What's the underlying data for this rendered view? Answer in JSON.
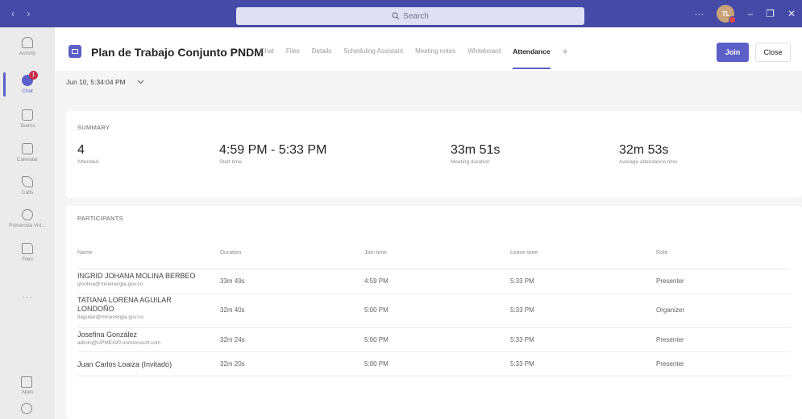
{
  "search": {
    "placeholder": "Search"
  },
  "titlebar": {
    "avatar_initials": "TL",
    "more": "···"
  },
  "rail": {
    "items": [
      {
        "label": "Activity",
        "icon": "bell-icon"
      },
      {
        "label": "Chat",
        "icon": "chat-icon",
        "badge": "1"
      },
      {
        "label": "Teams",
        "icon": "teams-icon"
      },
      {
        "label": "Calendar",
        "icon": "calendar-icon"
      },
      {
        "label": "Calls",
        "icon": "phone-icon"
      },
      {
        "label": "Presencia Virt...",
        "icon": "app-icon"
      },
      {
        "label": "Files",
        "icon": "file-icon"
      }
    ],
    "more": "···",
    "apps_label": "Apps"
  },
  "meeting": {
    "title": "Plan de Trabajo Conjunto PNDM",
    "tabs": [
      "Chat",
      "Files",
      "Details",
      "Scheduling Assistant",
      "Meeting notes",
      "Whiteboard",
      "Attendance"
    ],
    "active_tab": "Attendance",
    "add_tab": "+",
    "join_label": "Join",
    "close_label": "Close"
  },
  "date_selector": {
    "value": "Jun 10, 5:34:04 PM"
  },
  "summary": {
    "label": "SUMMARY",
    "stats": [
      {
        "value": "4",
        "caption": "Attended"
      },
      {
        "value": "4:59 PM - 5:33 PM",
        "caption": "Start time"
      },
      {
        "value": "33m 51s",
        "caption": "Meeting duration"
      },
      {
        "value": "32m 53s",
        "caption": "Average attendance time"
      }
    ]
  },
  "participants": {
    "label": "PARTICIPANTS",
    "columns": [
      "Name",
      "Duration",
      "Join time",
      "Leave time",
      "Role"
    ],
    "rows": [
      {
        "name": "INGRID JOHANA MOLINA BERBEO",
        "email": "ijmolina@minenergia.gov.co",
        "duration": "33m 49s",
        "join": "4:59 PM",
        "leave": "5:33 PM",
        "role": "Presenter"
      },
      {
        "name": "TATIANA LORENA AGUILAR LONDOÑO",
        "email": "tlaguilar@minenergia.gov.co",
        "duration": "32m 40s",
        "join": "5:00 PM",
        "leave": "5:33 PM",
        "role": "Organizer"
      },
      {
        "name": "Josefina González",
        "email": "admin@UPME420.onmicrosoft.com",
        "duration": "32m 24s",
        "join": "5:00 PM",
        "leave": "5:33 PM",
        "role": "Presenter"
      },
      {
        "name": "Juan Carlos Loaiza (Invitado)",
        "email": "",
        "duration": "32m 20s",
        "join": "5:00 PM",
        "leave": "5:33 PM",
        "role": "Presenter"
      }
    ]
  },
  "colors": {
    "titlebar": "#454aa6",
    "accent": "#5b5fc7",
    "rail": "#ebebeb",
    "badge": "#c4314b"
  }
}
